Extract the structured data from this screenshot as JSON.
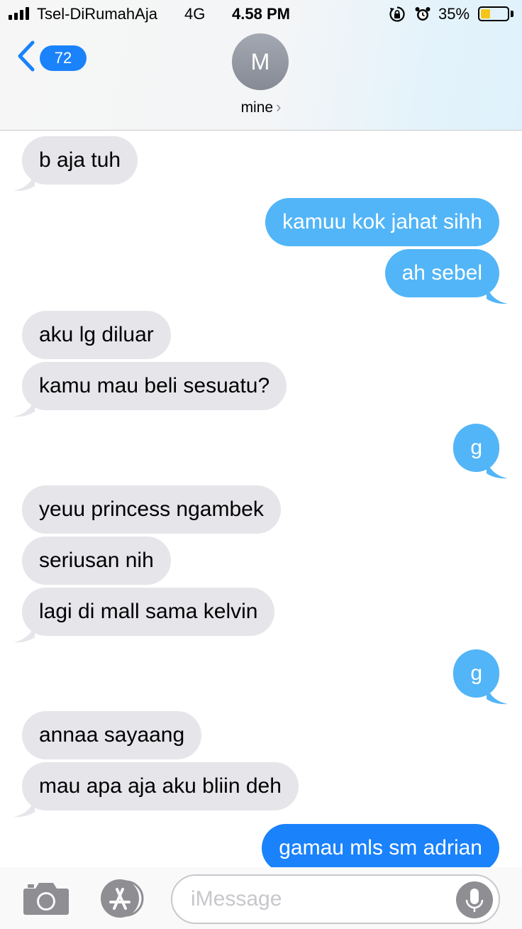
{
  "status_bar": {
    "carrier": "Tsel-DiRumahAja",
    "network": "4G",
    "time": "4.58 PM",
    "battery_percent": "35%",
    "battery_level": 0.35,
    "battery_color": "#f5c518",
    "icons": [
      "signal-icon",
      "rotation-lock-icon",
      "alarm-icon",
      "battery-icon"
    ]
  },
  "header": {
    "back_count": "72",
    "avatar_initial": "M",
    "contact_name": "mine",
    "chevron": "›"
  },
  "colors": {
    "incoming_bubble": "#e5e5ea",
    "outgoing_bubble": "#52b5f7",
    "outgoing_bubble_active": "#1a82fb",
    "accent": "#1a82fb"
  },
  "messages": [
    {
      "side": "incoming",
      "text": "b aja tuh"
    },
    {
      "side": "outgoing",
      "text": "kamuu kok jahat sihh"
    },
    {
      "side": "outgoing",
      "text": "ah sebel"
    },
    {
      "side": "incoming",
      "text": "aku lg diluar"
    },
    {
      "side": "incoming",
      "text": "kamu mau beli sesuatu?"
    },
    {
      "side": "outgoing",
      "text": "g"
    },
    {
      "side": "incoming",
      "text": "yeuu princess ngambek"
    },
    {
      "side": "incoming",
      "text": "seriusan nih"
    },
    {
      "side": "incoming",
      "text": "lagi di mall sama kelvin"
    },
    {
      "side": "outgoing",
      "text": "g"
    },
    {
      "side": "incoming",
      "text": "annaa sayaang"
    },
    {
      "side": "incoming",
      "text": "mau apa aja aku bliin deh"
    },
    {
      "side": "outgoing",
      "text": "gamau mls sm adrian"
    }
  ],
  "input_bar": {
    "placeholder": "iMessage",
    "icons": [
      "camera-icon",
      "app-store-icon",
      "microphone-icon"
    ]
  }
}
